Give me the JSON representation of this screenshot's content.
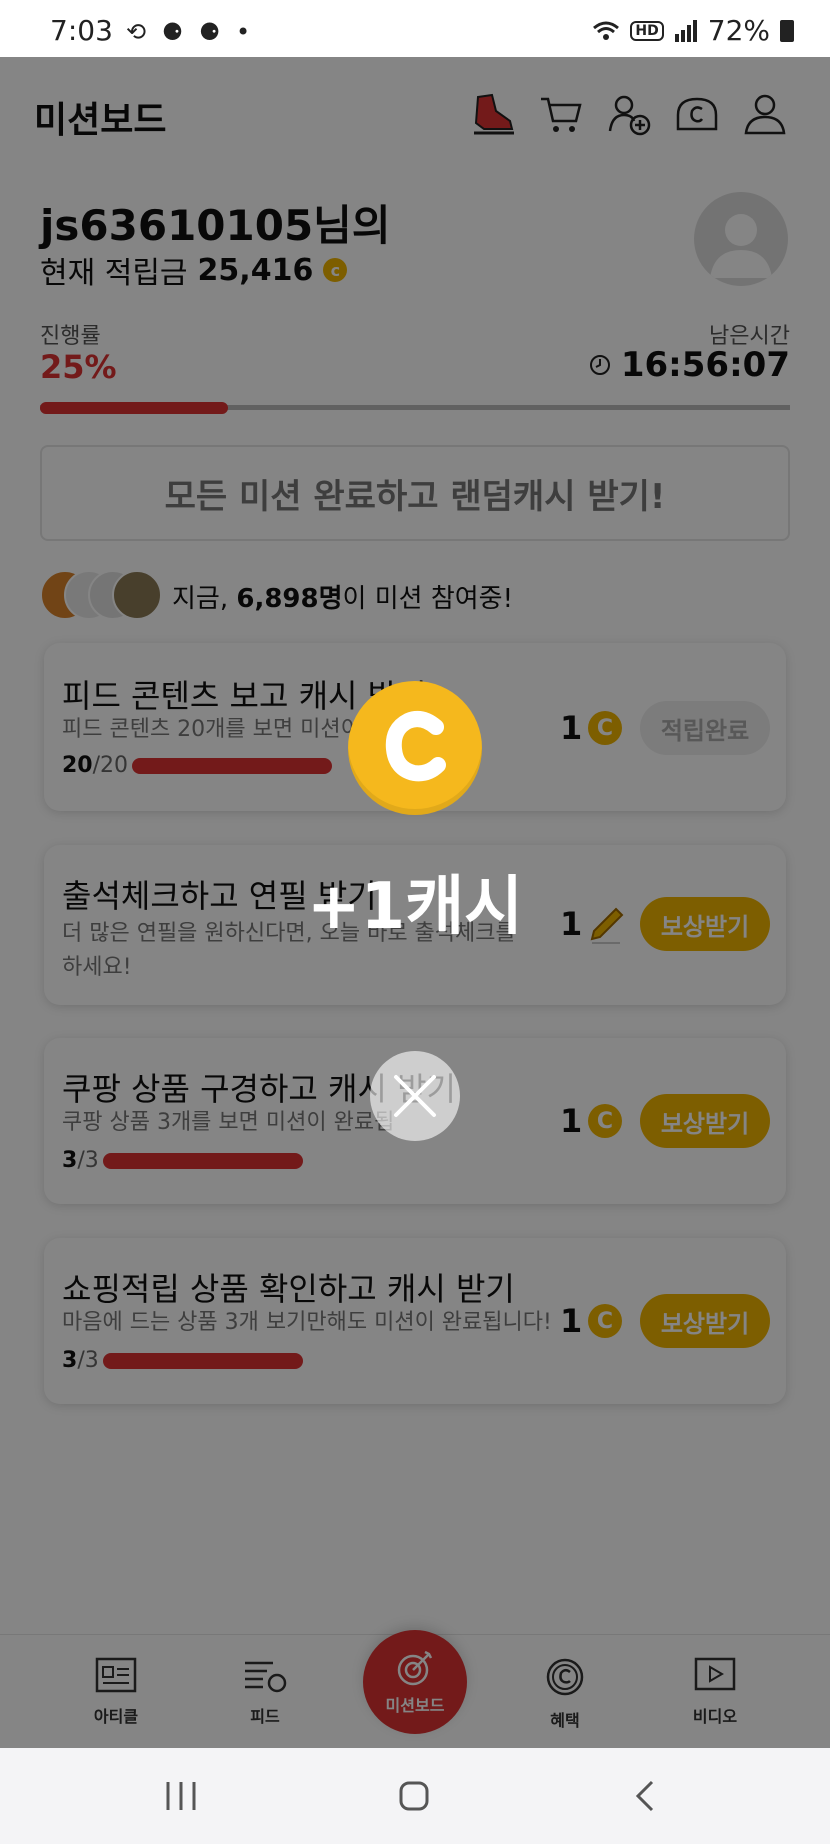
{
  "status_bar": {
    "time": "7:03",
    "notif_icons": "⟲ ⚈ ⚈ •",
    "hd": "HD",
    "battery": "72%"
  },
  "header": {
    "title": "미션보드",
    "icons": [
      "shoe-icon",
      "cart-icon",
      "add-friend-icon",
      "cash-icon",
      "profile-icon"
    ]
  },
  "user": {
    "name": "js63610105님의",
    "points_label": "현재 적립금",
    "points_value": "25,416",
    "coin": "c"
  },
  "progress": {
    "label": "진행률",
    "value": "25%",
    "fraction": 0.25,
    "remain_label": "남은시간",
    "remain_time": "16:56:07"
  },
  "all_mission_button": "모든 미션 완료하고 랜덤캐시 받기!",
  "participants": {
    "prefix": "지금, ",
    "count": "6,898명",
    "suffix": "이 미션 참여중!"
  },
  "missions": [
    {
      "title": "피드 콘텐츠 보고 캐시 받기",
      "desc": "피드 콘텐츠 20개를 보면 미션이",
      "progress_done": "20",
      "progress_total": "/20",
      "fraction": 1.0,
      "reward": "1",
      "reward_icon": "coin-icon",
      "button": "적립완료"
    },
    {
      "title": "출석체크하고 연필 받기",
      "desc1": "더 많은 연필을 원하신다면, 오늘 바로 출석체크를",
      "desc2": "하세요!",
      "reward": "1",
      "reward_icon": "pencil-icon",
      "button": "보상받기"
    },
    {
      "title": "쿠팡 상품 구경하고 캐시 받기",
      "desc": "쿠팡 상품 3개를 보면 미션이 완료됩",
      "progress_done": "3",
      "progress_total": "/3",
      "fraction": 1.0,
      "reward": "1",
      "reward_icon": "coin-icon",
      "button": "보상받기"
    },
    {
      "title": "쇼핑적립 상품 확인하고 캐시 받기",
      "desc": "마음에 드는 상품 3개 보기만해도 미션이 완료됩니다!",
      "progress_done": "3",
      "progress_total": "/3",
      "fraction": 1.0,
      "reward": "1",
      "reward_icon": "coin-icon",
      "button": "보상받기"
    }
  ],
  "bottom_nav": {
    "article": "아티클",
    "feed": "피드",
    "missionboard": "미션보드",
    "benefit": "혜택",
    "video": "비디오"
  },
  "popup": {
    "cash_text": "+1캐시",
    "coin_letter": "C"
  },
  "colors": {
    "accent_red": "#d33333",
    "coin_yellow": "#f0b400"
  }
}
